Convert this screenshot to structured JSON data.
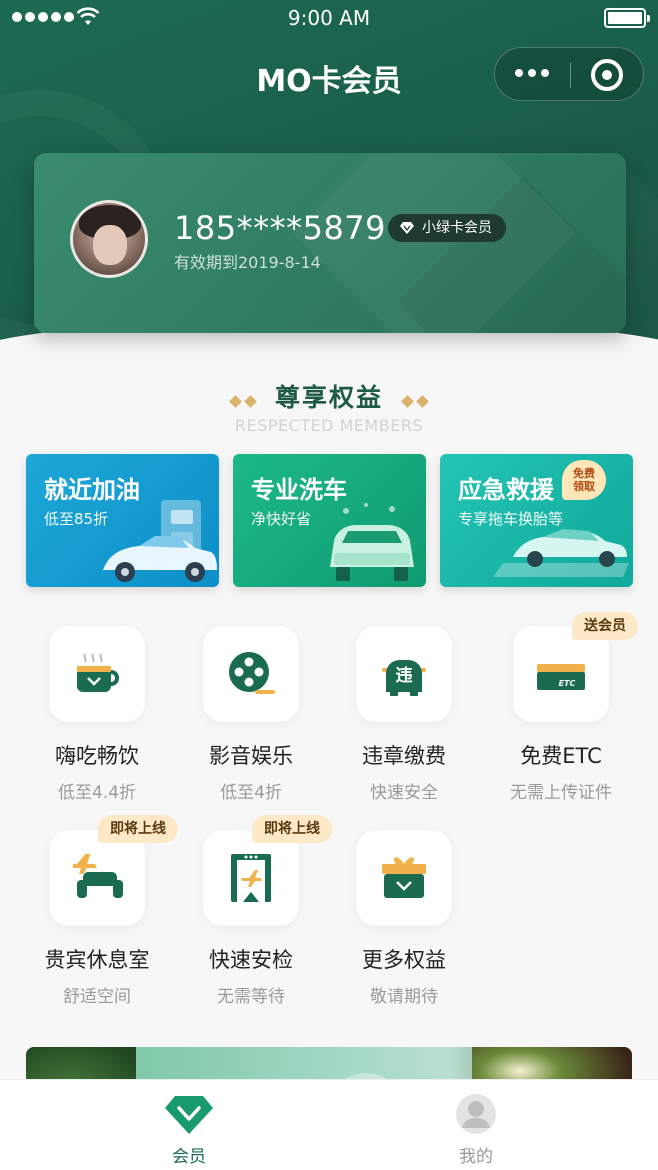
{
  "status_bar": {
    "time": "9:00 AM"
  },
  "nav": {
    "title": "MO卡会员"
  },
  "member_card": {
    "phone": "185****5879",
    "expiry": "有效期到2019-8-14",
    "badge": "小绿卡会员"
  },
  "section": {
    "title": "尊享权益",
    "subtitle": "RESPECTED MEMBERS"
  },
  "promos": [
    {
      "title": "就近加油",
      "subtitle": "低至85折"
    },
    {
      "title": "专业洗车",
      "subtitle": "净快好省"
    },
    {
      "title": "应急救援",
      "subtitle": "专享拖车换胎等",
      "tag": "免费领取"
    }
  ],
  "benefits": [
    {
      "name": "嗨吃畅饮",
      "desc": "低至4.4折",
      "icon": "coffee-cup-icon"
    },
    {
      "name": "影音娱乐",
      "desc": "低至4折",
      "icon": "film-reel-icon"
    },
    {
      "name": "违章缴费",
      "desc": "快速安全",
      "icon": "violation-car-icon",
      "icon_text": "违"
    },
    {
      "name": "免费ETC",
      "desc": "无需上传证件",
      "icon": "etc-card-icon",
      "ribbon": "送会员",
      "icon_text": "ETC"
    },
    {
      "name": "贵宾休息室",
      "desc": "舒适空间",
      "icon": "lounge-sofa-icon",
      "ribbon": "即将上线"
    },
    {
      "name": "快速安检",
      "desc": "无需等待",
      "icon": "security-gate-icon",
      "ribbon": "即将上线"
    },
    {
      "name": "更多权益",
      "desc": "敬请期待",
      "icon": "gift-box-icon"
    }
  ],
  "tabbar": {
    "member": "会员",
    "mine": "我的"
  },
  "colors": {
    "primary": "#1a6b50",
    "accent_gold": "#d9b36b"
  }
}
